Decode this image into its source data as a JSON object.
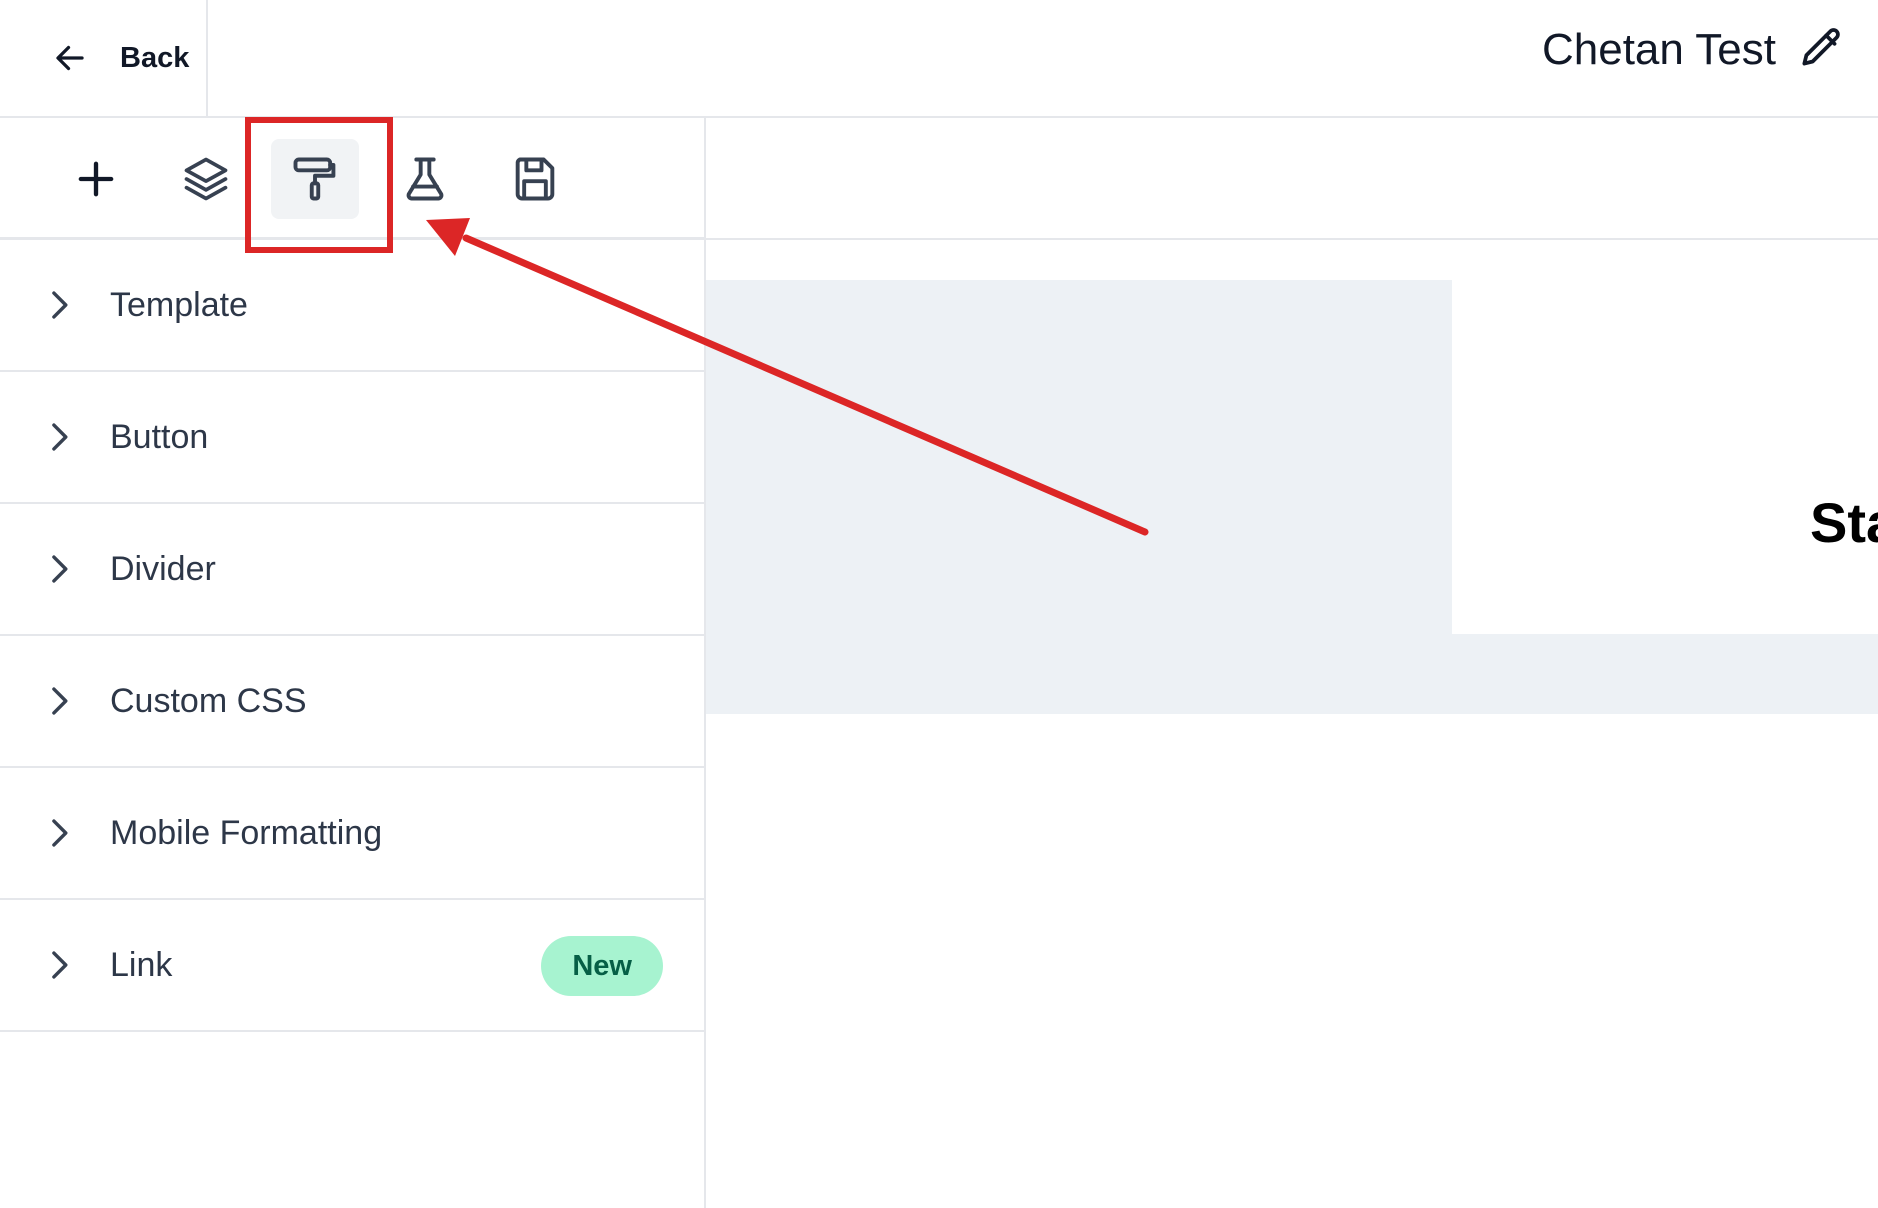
{
  "header": {
    "back_label": "Back",
    "title": "Chetan Test",
    "icons": {
      "back": "arrow-left-icon",
      "edit": "pencil-icon"
    }
  },
  "toolbar": {
    "tools": [
      {
        "icon": "plus-icon",
        "active": false
      },
      {
        "icon": "layers-icon",
        "active": false
      },
      {
        "icon": "paint-roller-icon",
        "active": true
      },
      {
        "icon": "flask-icon",
        "active": false
      },
      {
        "icon": "save-icon",
        "active": false
      }
    ]
  },
  "sections": [
    {
      "label": "Template"
    },
    {
      "label": "Button"
    },
    {
      "label": "Divider"
    },
    {
      "label": "Custom CSS"
    },
    {
      "label": "Mobile Formatting"
    },
    {
      "label": "Link",
      "badge": "New"
    }
  ],
  "canvas": {
    "heading_text": "Sta"
  },
  "colors": {
    "annotation": "#dc2626",
    "canvas_background": "#edf1f5",
    "badge_background": "#a7f3d0",
    "badge_text": "#065f46",
    "active_tool": "#f1f3f5"
  }
}
